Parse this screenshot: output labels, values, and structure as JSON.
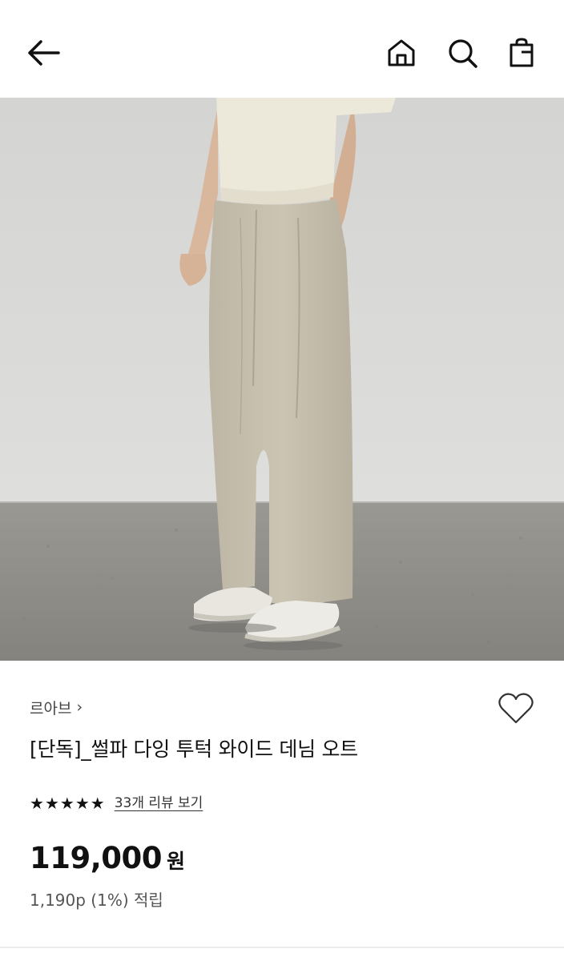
{
  "header": {
    "icons": [
      "back-arrow-icon",
      "home-icon",
      "search-icon",
      "shopping-bag-icon"
    ]
  },
  "product": {
    "image_icon": "product-photo",
    "brand": "르아브",
    "title": "[단독]_썰파 다잉 투턱 와이드 데님 오트",
    "rating": 5,
    "rating_max": 5,
    "review_link": "33개 리뷰 보기",
    "price": "119,000",
    "currency": "원",
    "points": "1,190p (1%) 적립",
    "wishlist_icon": "heart-outline-icon"
  },
  "colors": {
    "text": "#111111",
    "subtext": "#555555",
    "pants": "#c8c1b0",
    "sweater": "#ece8d8",
    "floor": "#8c8a85",
    "wall": "#d9d9d7"
  }
}
